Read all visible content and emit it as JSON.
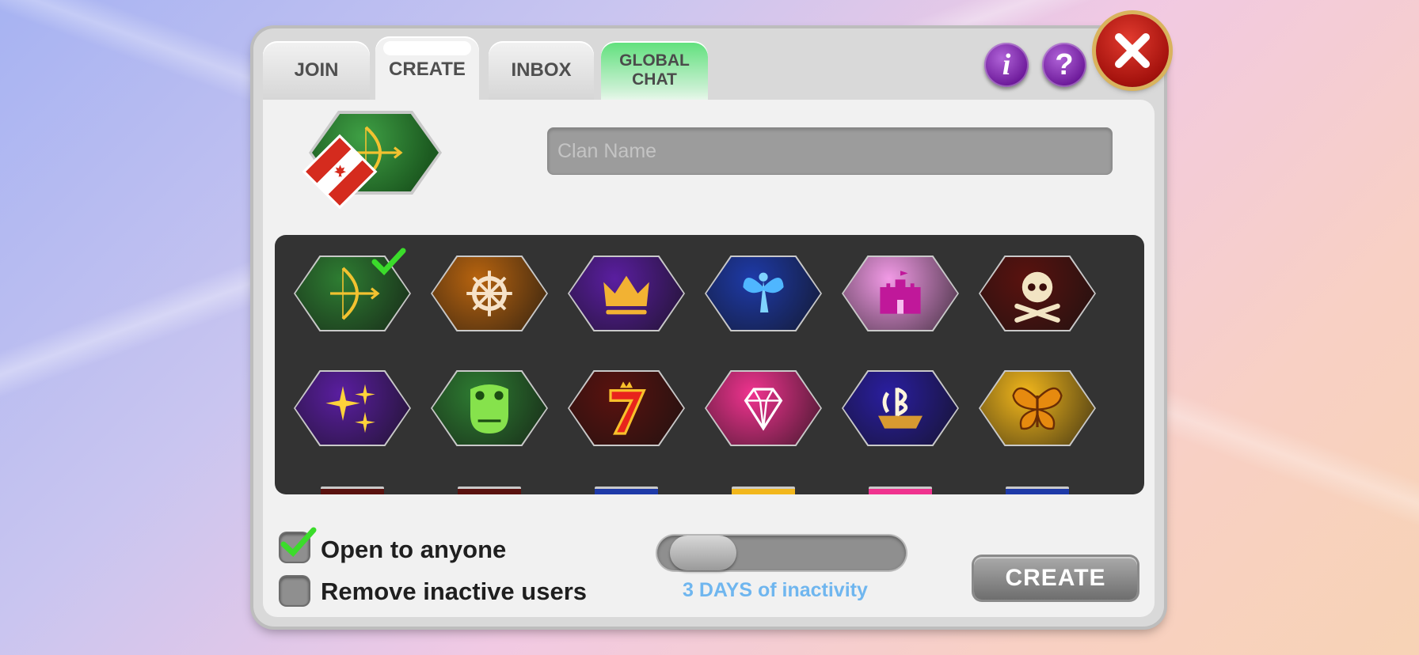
{
  "tabs": {
    "join": "JOIN",
    "create": "CREATE",
    "inbox": "INBOX",
    "global_chat_line1": "GLOBAL",
    "global_chat_line2": "CHAT"
  },
  "header": {
    "info_icon": "i",
    "help_icon": "?"
  },
  "clan_name": {
    "placeholder": "Clan Name",
    "value": ""
  },
  "preview": {
    "emblem": "bow-and-arrow",
    "flag": "canada-flag"
  },
  "emblems": [
    {
      "name": "bow-and-arrow",
      "color": "#2e7d32",
      "selected": true
    },
    {
      "name": "ship-wheel",
      "color": "#b8640f",
      "selected": false
    },
    {
      "name": "crown",
      "color": "#5a1ea0",
      "selected": false
    },
    {
      "name": "fairy",
      "color": "#1e3aa8",
      "selected": false
    },
    {
      "name": "castle",
      "color": "#f29ae6",
      "selected": false
    },
    {
      "name": "skull-crossbones",
      "color": "#5a120f",
      "selected": false
    },
    {
      "name": "sparkles",
      "color": "#5a1ea0",
      "selected": false
    },
    {
      "name": "crocodile",
      "color": "#2e7d32",
      "selected": false
    },
    {
      "name": "lucky-seven",
      "color": "#5a120f",
      "selected": false
    },
    {
      "name": "diamond",
      "color": "#f0338f",
      "selected": false
    },
    {
      "name": "galleon",
      "color": "#2a1ea0",
      "selected": false
    },
    {
      "name": "butterfly",
      "color": "#f2b71c",
      "selected": false
    }
  ],
  "options": {
    "open_to_anyone": "Open to anyone",
    "open_to_anyone_checked": true,
    "remove_inactive": "Remove inactive users",
    "remove_inactive_checked": false
  },
  "inactivity": {
    "label": "3 DAYS of inactivity",
    "level": 0.0
  },
  "create_button": "CREATE"
}
